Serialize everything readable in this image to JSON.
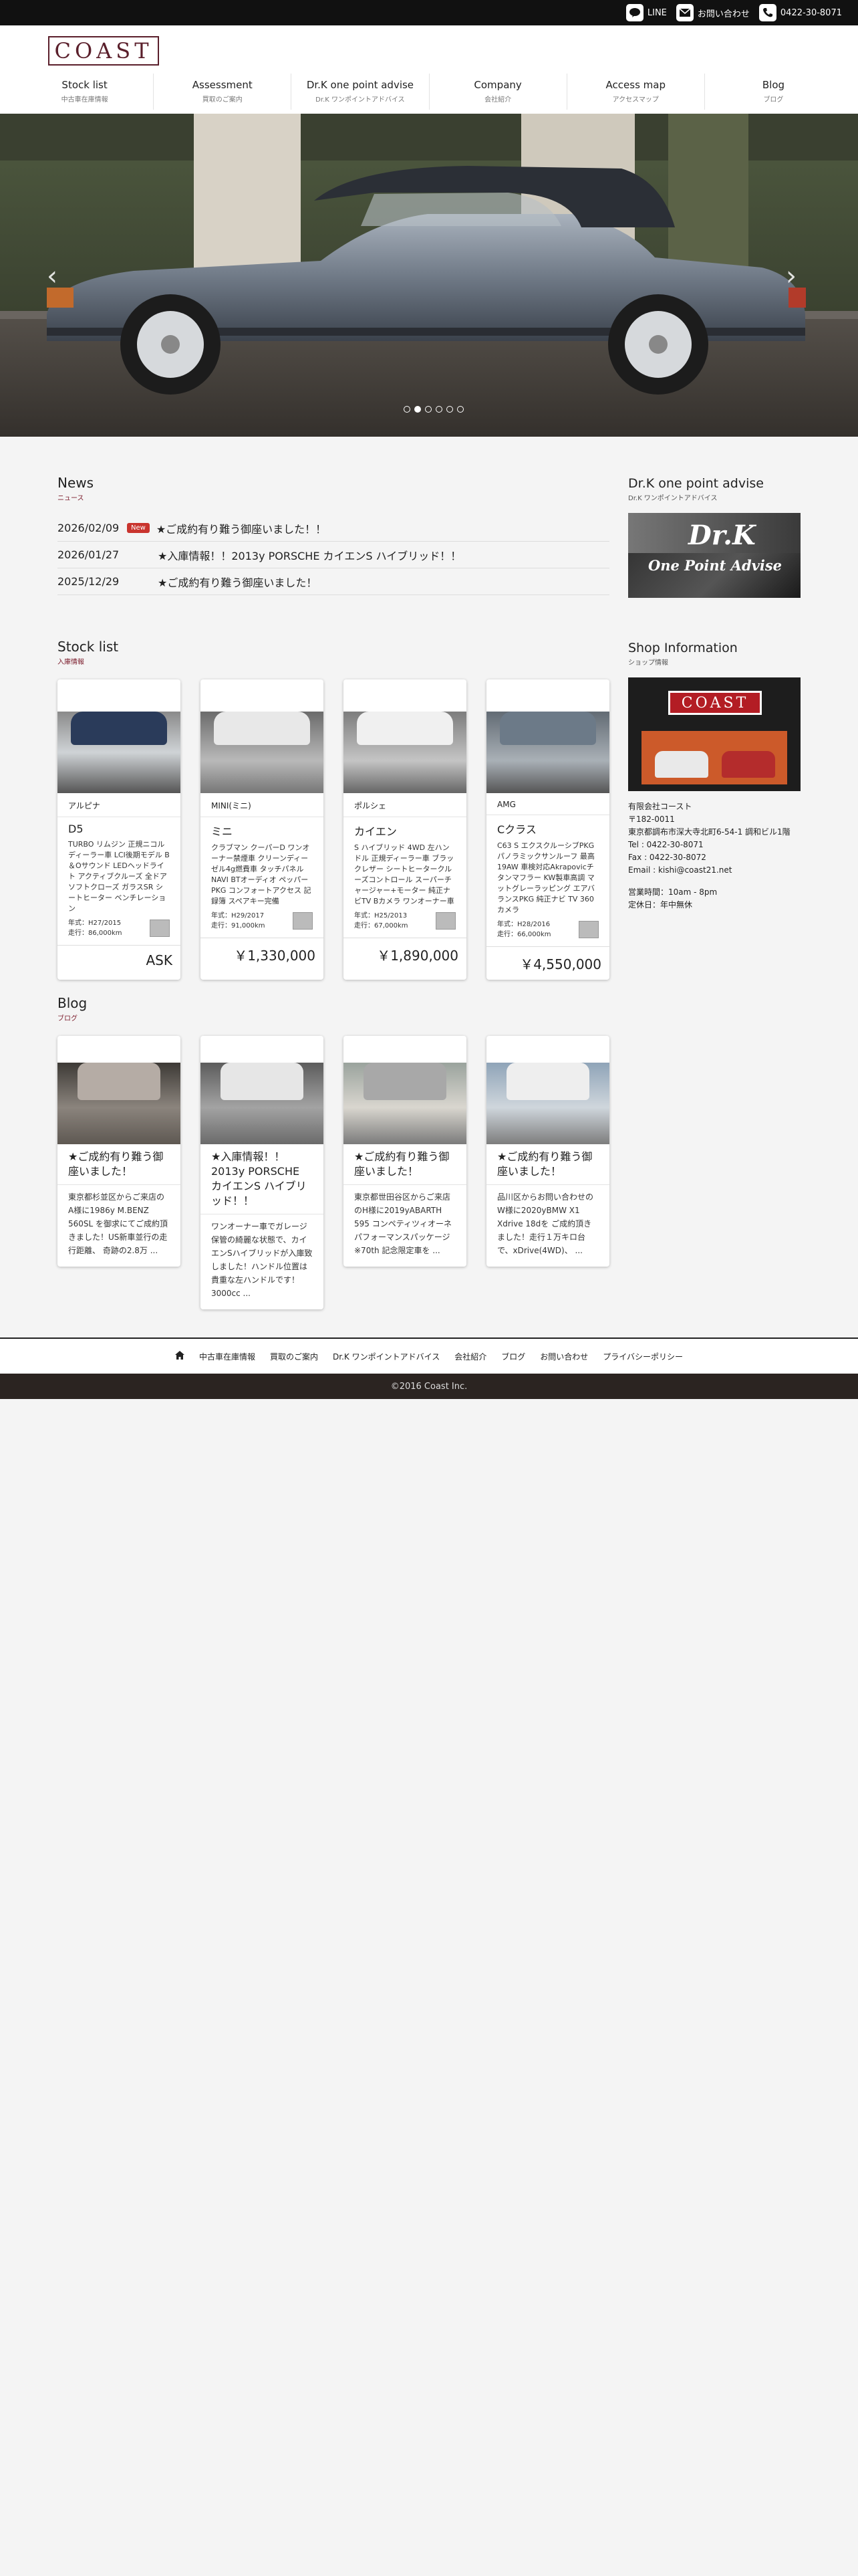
{
  "topbar": {
    "line_label": "LINE",
    "contact_label": "お問い合わせ",
    "phone": "0422-30-8071"
  },
  "brand": {
    "logo_text": "COAST"
  },
  "nav": [
    {
      "en": "Stock list",
      "ja": "中古車在庫情報"
    },
    {
      "en": "Assessment",
      "ja": "買取のご案内"
    },
    {
      "en": "Dr.K one point advise",
      "ja": "Dr.K ワンポイントアドバイス"
    },
    {
      "en": "Company",
      "ja": "会社紹介"
    },
    {
      "en": "Access map",
      "ja": "アクセスマップ"
    },
    {
      "en": "Blog",
      "ja": "ブログ"
    }
  ],
  "hero": {
    "dots": 6,
    "active_dot": 1
  },
  "news": {
    "title": "News",
    "sub": "ニュース",
    "items": [
      {
        "date": "2026/02/09",
        "badge": "New",
        "text": "★ご成約有り難う御座いました！！"
      },
      {
        "date": "2026/01/27",
        "badge": "",
        "text": "★入庫情報！！2013y PORSCHE カイエンS ハイブリッド！！"
      },
      {
        "date": "2025/12/29",
        "badge": "",
        "text": "★ご成約有り難う御座いました！"
      }
    ]
  },
  "advise": {
    "title": "Dr.K one point advise",
    "sub": "Dr.K ワンポイントアドバイス",
    "banner_line1": "Dr.K",
    "banner_line2": "One Point Advise"
  },
  "shop": {
    "title": "Shop Information",
    "sub": "ショップ情報",
    "sign": "COAST",
    "lines": [
      "有限会社コースト",
      "〒182-0011",
      "東京都調布市深大寺北町6-54-1 調和ビル1階",
      "Tel : 0422-30-8071",
      "Fax : 0422-30-8072",
      "Email : kishi@coast21.net"
    ],
    "hours": "営業時間：10am - 8pm",
    "holiday": "定休日：年中無休"
  },
  "stock": {
    "title": "Stock list",
    "sub": "入庫情報",
    "cars": [
      {
        "maker": "アルピナ",
        "model": "D5",
        "desc": "TURBO リムジン 正規ニコルディーラー車 LCI後期モデル B＆Oサウンド LEDヘッドライト アクティブクルーズ 全ドアソフトクローズ ガラスSR シートヒーター ベンチレーション",
        "year": "年式：H27/2015",
        "mileage": "走行：86,000km",
        "price": "ASK",
        "color": "#2a3b5a"
      },
      {
        "maker": "MINI(ミニ)",
        "model": "ミニ",
        "desc": "クラブマン クーパーD ワンオーナー禁煙車 クリーンディーゼル4g燃費車 タッチパネルNAVI BTオーディオ ペッパーPKG コンフォートアクセス 記録簿 スペアキー完備",
        "year": "年式：H29/2017",
        "mileage": "走行：91,000km",
        "price": "￥1,330,000",
        "color": "#e8e8e8"
      },
      {
        "maker": "ポルシェ",
        "model": "カイエン",
        "desc": "S ハイブリッド 4WD 左ハンドル 正規ディーラー車 ブラックレザー シートヒータークルーズコントロール スーパーチャージャー+モーター 純正ナビTV Bカメラ ワンオーナー車",
        "year": "年式：H25/2013",
        "mileage": "走行：67,000km",
        "price": "￥1,890,000",
        "color": "#f0f0f0"
      },
      {
        "maker": "AMG",
        "model": "Cクラス",
        "desc": "C63 S エクスクルーシブPKG パノラミックサンルーフ 最高19AW 車検対応Akrapovicチタンマフラー KW製車高調 マットグレーラッピング エアバランスPKG 純正ナビ TV 360カメラ",
        "year": "年式：H28/2016",
        "mileage": "走行：66,000km",
        "price": "￥4,550,000",
        "color": "#6c7a88"
      }
    ]
  },
  "blog": {
    "title": "Blog",
    "sub": "ブログ",
    "posts": [
      {
        "title": "★ご成約有り難う御座いました！",
        "excerpt": "東京都杉並区からご来店のA様に1986y M.BENZ 560SL を御求にてご成約頂きました！US新車並行の走行距離、 奇跡の2.8万 ...",
        "color": "#b5aca5"
      },
      {
        "title": "★入庫情報！！2013y PORSCHE カイエンS ハイブリッド！！",
        "excerpt": "ワンオーナー車でガレージ保管の綺麗な状態で、カイエンSハイブリッドが入庫致しました！ハンドル位置は貴重な左ハンドルです！3000cc ...",
        "color": "#e6e6e6"
      },
      {
        "title": "★ご成約有り難う御座いました！",
        "excerpt": "東京都世田谷区からご来店のH様に2019yABARTH 595 コンペティツィオーネ パフォーマンスパッケージ※70th 記念限定車を ...",
        "color": "#a8a8a8"
      },
      {
        "title": "★ご成約有り難う御座いました！",
        "excerpt": "品川区からお問い合わせのW様に2020yBMW X1 Xdrive 18dを ご成約頂きました！走行１万キロ台で、xDrive(4WD)、 ...",
        "color": "#eeeeee"
      }
    ]
  },
  "footer": {
    "links": [
      "中古車在庫情報",
      "買取のご案内",
      "Dr.K ワンポイントアドバイス",
      "会社紹介",
      "ブログ",
      "お問い合わせ",
      "プライバシーポリシー"
    ],
    "copyright": "©2016 Coast Inc."
  }
}
